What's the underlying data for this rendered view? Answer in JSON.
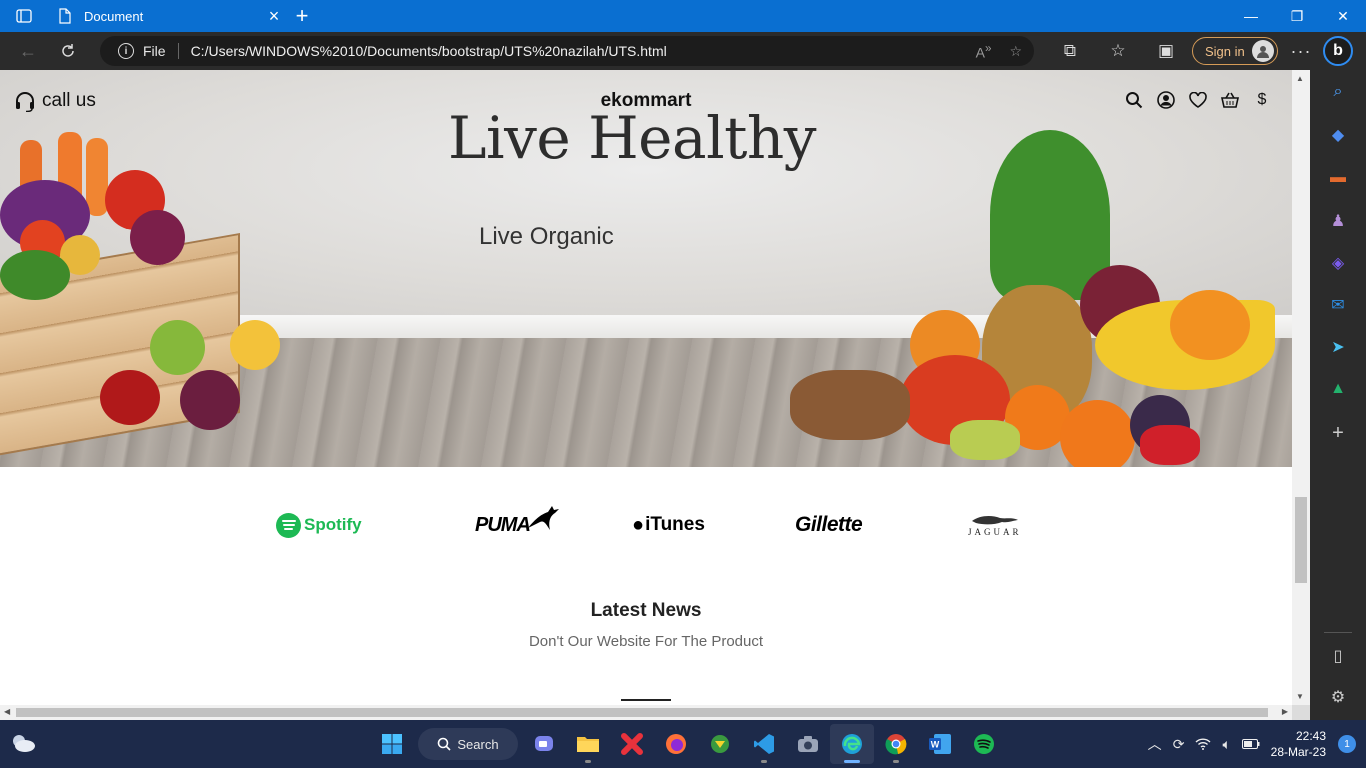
{
  "browser": {
    "tab_title": "Document",
    "address": {
      "scheme": "File",
      "url": "C:/Users/WINDOWS%2010/Documents/bootstrap/UTS%20nazilah/UTS.html"
    },
    "signin_label": "Sign in"
  },
  "page": {
    "callus": "call us",
    "brand": "ekommart",
    "headline": "Live Healthy",
    "subline": "Live Organic",
    "partner_brands": {
      "spotify": "Spotify",
      "puma": "PUMA",
      "itunes": "iTunes",
      "gillette": "Gillette",
      "jaguar": "JAGUAR"
    },
    "news": {
      "title": "Latest News",
      "subtitle": "Don't Our Website For The Product"
    }
  },
  "taskbar": {
    "search_label": "Search",
    "time": "22:43",
    "date": "28-Mar-23",
    "notification_count": "1"
  },
  "colors": {
    "titlebar": "#0a6fd1",
    "toolbar": "#2b2b2b",
    "taskbar": "#1d2a4a",
    "spotify_green": "#1db954"
  }
}
